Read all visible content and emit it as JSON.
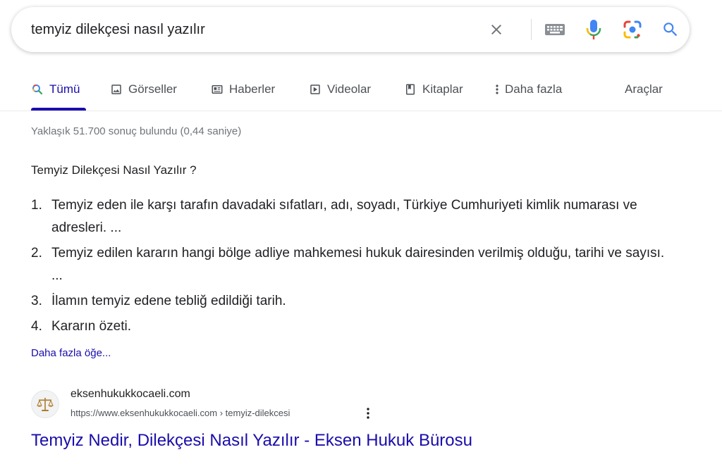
{
  "search": {
    "query": "temyiz dilekçesi nasıl yazılır"
  },
  "tabs": [
    {
      "label": "Tümü",
      "icon": "search-icon",
      "active": true
    },
    {
      "label": "Görseller",
      "icon": "image-icon"
    },
    {
      "label": "Haberler",
      "icon": "news-icon"
    },
    {
      "label": "Videolar",
      "icon": "video-icon"
    },
    {
      "label": "Kitaplar",
      "icon": "book-icon"
    },
    {
      "label": "Daha fazla",
      "icon": "more-vert-icon"
    }
  ],
  "tools_label": "Araçlar",
  "stats": "Yaklaşık 51.700 sonuç bulundu (0,44 saniye)",
  "snippet": {
    "title": "Temyiz Dilekçesi Nasıl Yazılır ?",
    "items": [
      {
        "num": "1.",
        "text": "Temyiz eden ile karşı tarafın davadaki sıfatları, adı, soyadı, Türkiye Cumhuriyeti kimlik numarası ve adresleri. ..."
      },
      {
        "num": "2.",
        "text": "Temyiz edilen kararın hangi bölge adliye mahkemesi hukuk dairesinden verilmiş olduğu, tarihi ve sayısı. ..."
      },
      {
        "num": "3.",
        "text": "İlamın temyiz edene tebliğ edildiği tarih."
      },
      {
        "num": "4.",
        "text": "Kararın özeti."
      }
    ],
    "more_label": "Daha fazla öğe..."
  },
  "result": {
    "site_name": "eksenhukukkocaeli.com",
    "url": "https://www.eksenhukukkocaeli.com › temyiz-dilekcesi",
    "title": "Temyiz Nedir, Dilekçesi Nasıl Yazılır - Eksen Hukuk Bürosu",
    "favicon": "scales-icon"
  },
  "colors": {
    "link": "#1a0dab",
    "google_blue": "#4285f4",
    "google_red": "#ea4335",
    "google_yellow": "#fbbc04",
    "google_green": "#34a853"
  }
}
